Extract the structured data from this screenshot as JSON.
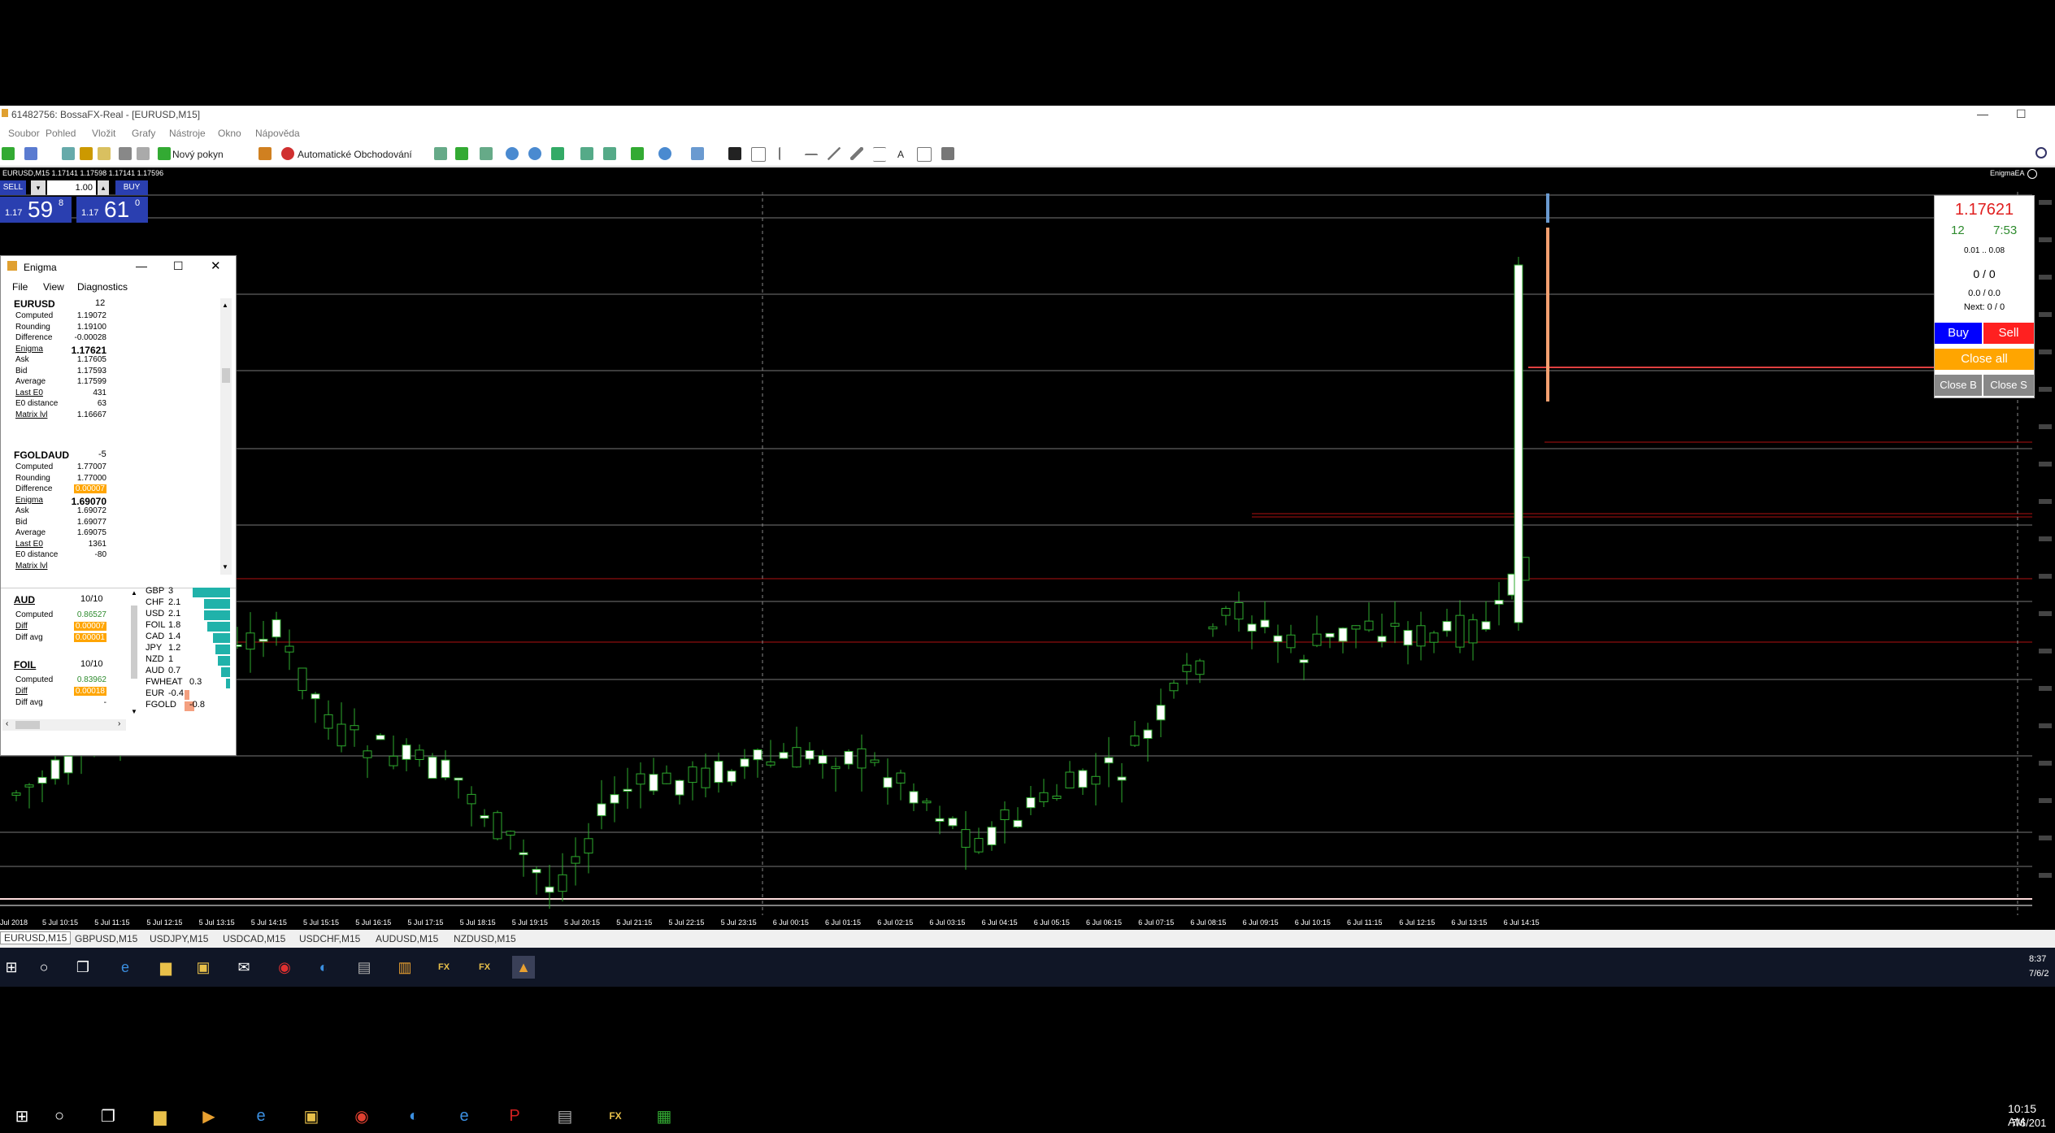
{
  "window": {
    "title": "61482756: BossaFX-Real - [EURUSD,M15]",
    "menu": [
      "Soubor",
      "Pohled",
      "Vložit",
      "Grafy",
      "Nástroje",
      "Okno",
      "Nápověda"
    ]
  },
  "toolbar": {
    "new_order": "Nový pokyn",
    "auto_trading": "Automatické Obchodování"
  },
  "chart": {
    "header": "EURUSD,M15  1.17141 1.17598 1.17141 1.17596",
    "ea_label": "EnigmaEA",
    "one_click": {
      "sell_label": "SELL",
      "buy_label": "BUY",
      "lot": "1.00",
      "sell_prefix": "1.17",
      "sell_big": "59",
      "sell_sup": "8",
      "buy_prefix": "1.17",
      "buy_big": "61",
      "buy_sup": "0"
    },
    "time_labels": [
      "Jul 2018",
      "5 Jul 10:15",
      "5 Jul 11:15",
      "5 Jul 12:15",
      "5 Jul 13:15",
      "5 Jul 14:15",
      "5 Jul 15:15",
      "5 Jul 16:15",
      "5 Jul 17:15",
      "5 Jul 18:15",
      "5 Jul 19:15",
      "5 Jul 20:15",
      "5 Jul 21:15",
      "5 Jul 22:15",
      "5 Jul 23:15",
      "6 Jul 00:15",
      "6 Jul 01:15",
      "6 Jul 02:15",
      "6 Jul 03:15",
      "6 Jul 04:15",
      "6 Jul 05:15",
      "6 Jul 06:15",
      "6 Jul 07:15",
      "6 Jul 08:15",
      "6 Jul 09:15",
      "6 Jul 10:15",
      "6 Jul 11:15",
      "6 Jul 12:15",
      "6 Jul 13:15",
      "6 Jul 14:15"
    ]
  },
  "tabs": [
    "EURUSD,M15",
    "GBPUSD,M15",
    "USDJPY,M15",
    "USDCAD,M15",
    "USDCHF,M15",
    "AUDUSD,M15",
    "NZDUSD,M15"
  ],
  "trade_panel": {
    "price": "1.17621",
    "count": "12",
    "time": "7:53",
    "range": "0.01 .. 0.08",
    "positions": "0 / 0",
    "pl": "0.0 / 0.0",
    "next": "Next: 0 / 0",
    "buy": "Buy",
    "sell": "Sell",
    "close_all": "Close all",
    "close_b": "Close B",
    "close_s": "Close S"
  },
  "enigma": {
    "title": "Enigma",
    "menu": [
      "File",
      "View",
      "Diagnostics"
    ],
    "eurusd": {
      "name": "EURUSD",
      "count": "12",
      "rows": [
        {
          "k": "Computed",
          "v": "1.19072"
        },
        {
          "k": "Rounding",
          "v": "1.19100"
        },
        {
          "k": "Difference",
          "v": "-0.00028"
        },
        {
          "k": "Enigma",
          "v": "1.17621"
        },
        {
          "k": "Ask",
          "v": "1.17605"
        },
        {
          "k": "Bid",
          "v": "1.17593"
        },
        {
          "k": "Average",
          "v": "1.17599"
        },
        {
          "k": "Last E0",
          "v": "431"
        },
        {
          "k": "E0 distance",
          "v": "63"
        },
        {
          "k": "Matrix lvl",
          "v": "1.16667"
        }
      ]
    },
    "fgoldaud": {
      "name": "FGOLDAUD",
      "count": "-5",
      "rows": [
        {
          "k": "Computed",
          "v": "1.77007"
        },
        {
          "k": "Rounding",
          "v": "1.77000"
        },
        {
          "k": "Difference",
          "v": "0.00007"
        },
        {
          "k": "Enigma",
          "v": "1.69070"
        },
        {
          "k": "Ask",
          "v": "1.69072"
        },
        {
          "k": "Bid",
          "v": "1.69077"
        },
        {
          "k": "Average",
          "v": "1.69075"
        },
        {
          "k": "Last E0",
          "v": "1361"
        },
        {
          "k": "E0 distance",
          "v": "-80"
        },
        {
          "k": "Matrix lvl",
          "v": ""
        }
      ]
    },
    "aud": {
      "name": "AUD",
      "count": "10/10",
      "rows": [
        {
          "k": "Computed",
          "v": "0.86527"
        },
        {
          "k": "Diff",
          "v": "0.00007"
        },
        {
          "k": "Diff avg",
          "v": "0.00001"
        }
      ]
    },
    "foil": {
      "name": "FOIL",
      "count": "10/10",
      "rows": [
        {
          "k": "Computed",
          "v": "0.83962"
        },
        {
          "k": "Diff",
          "v": "0.00018"
        },
        {
          "k": "Diff avg",
          "v": "-"
        }
      ]
    },
    "strength": [
      {
        "k": "GBP",
        "v": "3",
        "level": 3
      },
      {
        "k": "CHF",
        "v": "2.1",
        "level": 2.1
      },
      {
        "k": "USD",
        "v": "2.1",
        "level": 2.1
      },
      {
        "k": "FOIL",
        "v": "1.8",
        "level": 1.8
      },
      {
        "k": "CAD",
        "v": "1.4",
        "level": 1.4
      },
      {
        "k": "JPY",
        "v": "1.2",
        "level": 1.2
      },
      {
        "k": "NZD",
        "v": "1",
        "level": 1
      },
      {
        "k": "AUD",
        "v": "0.7",
        "level": 0.7
      },
      {
        "k": "FWHEAT",
        "v": "0.3",
        "level": 0.3
      },
      {
        "k": "EUR",
        "v": "-0.4",
        "level": -0.4
      },
      {
        "k": "FGOLD",
        "v": "-0.8",
        "level": -0.8
      }
    ]
  },
  "taskbar": {
    "clock_inner": "8:37",
    "date_inner": "7/6/2",
    "clock_outer": "10:15 AM",
    "date_outer": "7/6/201"
  },
  "colors": {
    "buy": "#0000ff",
    "sell": "#ff2020",
    "close_all": "#ffa500",
    "teal": "#20b2aa"
  }
}
